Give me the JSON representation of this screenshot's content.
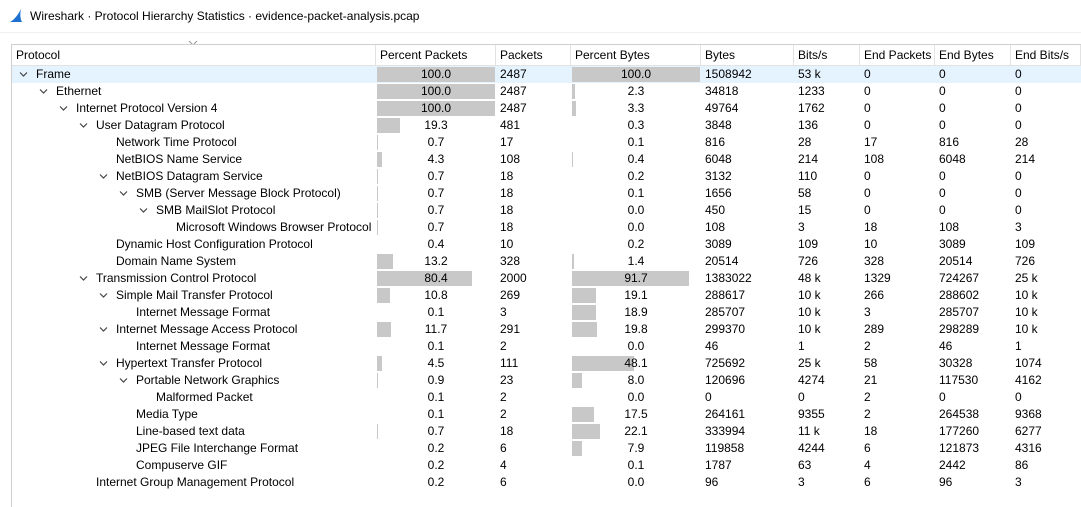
{
  "window": {
    "title": "Wireshark · Protocol Hierarchy Statistics · evidence-packet-analysis.pcap",
    "icon": "wireshark-fin-icon",
    "accent": "#1e6fd0"
  },
  "columns": [
    "Protocol",
    "Percent Packets",
    "Packets",
    "Percent Bytes",
    "Bytes",
    "Bits/s",
    "End Packets",
    "End Bytes",
    "End Bits/s"
  ],
  "rows": [
    {
      "depth": 0,
      "expand": true,
      "selected": true,
      "name": "Frame",
      "pct_packets": "100.0",
      "packets": "2487",
      "pct_bytes": "100.0",
      "bytes": "1508942",
      "bits_s": "53 k",
      "end_packets": "0",
      "end_bytes": "0",
      "end_bits_s": "0"
    },
    {
      "depth": 1,
      "expand": true,
      "name": "Ethernet",
      "pct_packets": "100.0",
      "packets": "2487",
      "pct_bytes": "2.3",
      "bytes": "34818",
      "bits_s": "1233",
      "end_packets": "0",
      "end_bytes": "0",
      "end_bits_s": "0"
    },
    {
      "depth": 2,
      "expand": true,
      "name": "Internet Protocol Version 4",
      "pct_packets": "100.0",
      "packets": "2487",
      "pct_bytes": "3.3",
      "bytes": "49764",
      "bits_s": "1762",
      "end_packets": "0",
      "end_bytes": "0",
      "end_bits_s": "0"
    },
    {
      "depth": 3,
      "expand": true,
      "name": "User Datagram Protocol",
      "pct_packets": "19.3",
      "packets": "481",
      "pct_bytes": "0.3",
      "bytes": "3848",
      "bits_s": "136",
      "end_packets": "0",
      "end_bytes": "0",
      "end_bits_s": "0"
    },
    {
      "depth": 4,
      "expand": false,
      "name": "Network Time Protocol",
      "pct_packets": "0.7",
      "packets": "17",
      "pct_bytes": "0.1",
      "bytes": "816",
      "bits_s": "28",
      "end_packets": "17",
      "end_bytes": "816",
      "end_bits_s": "28"
    },
    {
      "depth": 4,
      "expand": false,
      "name": "NetBIOS Name Service",
      "pct_packets": "4.3",
      "packets": "108",
      "pct_bytes": "0.4",
      "bytes": "6048",
      "bits_s": "214",
      "end_packets": "108",
      "end_bytes": "6048",
      "end_bits_s": "214"
    },
    {
      "depth": 4,
      "expand": true,
      "name": "NetBIOS Datagram Service",
      "pct_packets": "0.7",
      "packets": "18",
      "pct_bytes": "0.2",
      "bytes": "3132",
      "bits_s": "110",
      "end_packets": "0",
      "end_bytes": "0",
      "end_bits_s": "0"
    },
    {
      "depth": 5,
      "expand": true,
      "name": "SMB (Server Message Block Protocol)",
      "pct_packets": "0.7",
      "packets": "18",
      "pct_bytes": "0.1",
      "bytes": "1656",
      "bits_s": "58",
      "end_packets": "0",
      "end_bytes": "0",
      "end_bits_s": "0"
    },
    {
      "depth": 6,
      "expand": true,
      "name": "SMB MailSlot Protocol",
      "pct_packets": "0.7",
      "packets": "18",
      "pct_bytes": "0.0",
      "bytes": "450",
      "bits_s": "15",
      "end_packets": "0",
      "end_bytes": "0",
      "end_bits_s": "0"
    },
    {
      "depth": 7,
      "expand": false,
      "name": "Microsoft Windows Browser Protocol",
      "pct_packets": "0.7",
      "packets": "18",
      "pct_bytes": "0.0",
      "bytes": "108",
      "bits_s": "3",
      "end_packets": "18",
      "end_bytes": "108",
      "end_bits_s": "3"
    },
    {
      "depth": 4,
      "expand": false,
      "name": "Dynamic Host Configuration Protocol",
      "pct_packets": "0.4",
      "packets": "10",
      "pct_bytes": "0.2",
      "bytes": "3089",
      "bits_s": "109",
      "end_packets": "10",
      "end_bytes": "3089",
      "end_bits_s": "109"
    },
    {
      "depth": 4,
      "expand": false,
      "name": "Domain Name System",
      "pct_packets": "13.2",
      "packets": "328",
      "pct_bytes": "1.4",
      "bytes": "20514",
      "bits_s": "726",
      "end_packets": "328",
      "end_bytes": "20514",
      "end_bits_s": "726"
    },
    {
      "depth": 3,
      "expand": true,
      "name": "Transmission Control Protocol",
      "pct_packets": "80.4",
      "packets": "2000",
      "pct_bytes": "91.7",
      "bytes": "1383022",
      "bits_s": "48 k",
      "end_packets": "1329",
      "end_bytes": "724267",
      "end_bits_s": "25 k"
    },
    {
      "depth": 4,
      "expand": true,
      "name": "Simple Mail Transfer Protocol",
      "pct_packets": "10.8",
      "packets": "269",
      "pct_bytes": "19.1",
      "bytes": "288617",
      "bits_s": "10 k",
      "end_packets": "266",
      "end_bytes": "288602",
      "end_bits_s": "10 k"
    },
    {
      "depth": 5,
      "expand": false,
      "name": "Internet Message Format",
      "pct_packets": "0.1",
      "packets": "3",
      "pct_bytes": "18.9",
      "bytes": "285707",
      "bits_s": "10 k",
      "end_packets": "3",
      "end_bytes": "285707",
      "end_bits_s": "10 k"
    },
    {
      "depth": 4,
      "expand": true,
      "name": "Internet Message Access Protocol",
      "pct_packets": "11.7",
      "packets": "291",
      "pct_bytes": "19.8",
      "bytes": "299370",
      "bits_s": "10 k",
      "end_packets": "289",
      "end_bytes": "298289",
      "end_bits_s": "10 k"
    },
    {
      "depth": 5,
      "expand": false,
      "name": "Internet Message Format",
      "pct_packets": "0.1",
      "packets": "2",
      "pct_bytes": "0.0",
      "bytes": "46",
      "bits_s": "1",
      "end_packets": "2",
      "end_bytes": "46",
      "end_bits_s": "1"
    },
    {
      "depth": 4,
      "expand": true,
      "name": "Hypertext Transfer Protocol",
      "pct_packets": "4.5",
      "packets": "111",
      "pct_bytes": "48.1",
      "bytes": "725692",
      "bits_s": "25 k",
      "end_packets": "58",
      "end_bytes": "30328",
      "end_bits_s": "1074"
    },
    {
      "depth": 5,
      "expand": true,
      "name": "Portable Network Graphics",
      "pct_packets": "0.9",
      "packets": "23",
      "pct_bytes": "8.0",
      "bytes": "120696",
      "bits_s": "4274",
      "end_packets": "21",
      "end_bytes": "117530",
      "end_bits_s": "4162"
    },
    {
      "depth": 6,
      "expand": false,
      "name": "Malformed Packet",
      "pct_packets": "0.1",
      "packets": "2",
      "pct_bytes": "0.0",
      "bytes": "0",
      "bits_s": "0",
      "end_packets": "2",
      "end_bytes": "0",
      "end_bits_s": "0"
    },
    {
      "depth": 5,
      "expand": false,
      "name": "Media Type",
      "pct_packets": "0.1",
      "packets": "2",
      "pct_bytes": "17.5",
      "bytes": "264161",
      "bits_s": "9355",
      "end_packets": "2",
      "end_bytes": "264538",
      "end_bits_s": "9368"
    },
    {
      "depth": 5,
      "expand": false,
      "name": "Line-based text data",
      "pct_packets": "0.7",
      "packets": "18",
      "pct_bytes": "22.1",
      "bytes": "333994",
      "bits_s": "11 k",
      "end_packets": "18",
      "end_bytes": "177260",
      "end_bits_s": "6277"
    },
    {
      "depth": 5,
      "expand": false,
      "name": "JPEG File Interchange Format",
      "pct_packets": "0.2",
      "packets": "6",
      "pct_bytes": "7.9",
      "bytes": "119858",
      "bits_s": "4244",
      "end_packets": "6",
      "end_bytes": "121873",
      "end_bits_s": "4316"
    },
    {
      "depth": 5,
      "expand": false,
      "name": "Compuserve GIF",
      "pct_packets": "0.2",
      "packets": "4",
      "pct_bytes": "0.1",
      "bytes": "1787",
      "bits_s": "63",
      "end_packets": "4",
      "end_bytes": "2442",
      "end_bits_s": "86"
    },
    {
      "depth": 3,
      "expand": false,
      "name": "Internet Group Management Protocol",
      "pct_packets": "0.2",
      "packets": "6",
      "pct_bytes": "0.0",
      "bytes": "96",
      "bits_s": "3",
      "end_packets": "6",
      "end_bytes": "96",
      "end_bits_s": "3"
    }
  ]
}
